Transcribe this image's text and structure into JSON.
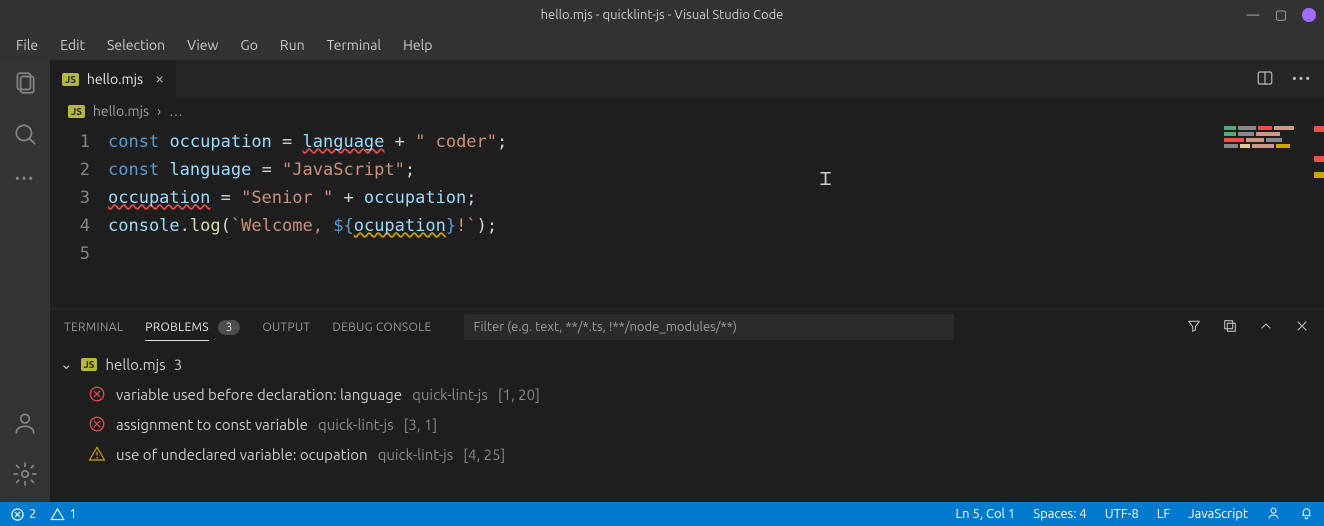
{
  "window": {
    "title": "hello.mjs - quicklint-js - Visual Studio Code"
  },
  "menubar": [
    "File",
    "Edit",
    "Selection",
    "View",
    "Go",
    "Run",
    "Terminal",
    "Help"
  ],
  "tabs": {
    "active": {
      "icon_text": "JS",
      "label": "hello.mjs"
    }
  },
  "breadcrumbs": {
    "icon_text": "JS",
    "file": "hello.mjs",
    "sep": "›",
    "tail": "…"
  },
  "gutter": [
    "1",
    "2",
    "3",
    "4",
    "5"
  ],
  "code": {
    "l1": {
      "kw": "const",
      "id": "occupation",
      "op1": " = ",
      "use": "language",
      "op2": " + ",
      "str": "\" coder\"",
      "semi": ";"
    },
    "l2": {
      "kw": "const",
      "id": "language",
      "op1": " = ",
      "str": "\"JavaScript\"",
      "semi": ";"
    },
    "l3": {
      "id": "occupation",
      "op1": " = ",
      "str": "\"Senior \"",
      "op2": " + ",
      "use": "occupation",
      "semi": ";"
    },
    "l4": {
      "obj": "console",
      "dot": ".",
      "fn": "log",
      "open": "(",
      "tpl1": "`Welcome, ",
      "iopen": "${",
      "var": "ocupation",
      "iclose": "}",
      "tpl2": "!`",
      "close": ")",
      "semi": ";"
    }
  },
  "panel": {
    "tabs": {
      "terminal": "TERMINAL",
      "problems": "PROBLEMS",
      "problems_count": "3",
      "output": "OUTPUT",
      "debug": "DEBUG CONSOLE"
    },
    "filter_placeholder": "Filter (e.g. text, **/*.ts, !**/node_modules/**)",
    "file": {
      "icon_text": "JS",
      "name": "hello.mjs",
      "count": "3"
    },
    "items": [
      {
        "sev": "error",
        "msg": "variable used before declaration: language",
        "src": "quick-lint-js",
        "loc": "[1, 20]"
      },
      {
        "sev": "error",
        "msg": "assignment to const variable",
        "src": "quick-lint-js",
        "loc": "[3, 1]"
      },
      {
        "sev": "warning",
        "msg": "use of undeclared variable: ocupation",
        "src": "quick-lint-js",
        "loc": "[4, 25]"
      }
    ]
  },
  "statusbar": {
    "errors": "2",
    "warnings": "1",
    "lncol": "Ln 5, Col 1",
    "spaces": "Spaces: 4",
    "enc": "UTF-8",
    "eol": "LF",
    "lang": "JavaScript"
  }
}
